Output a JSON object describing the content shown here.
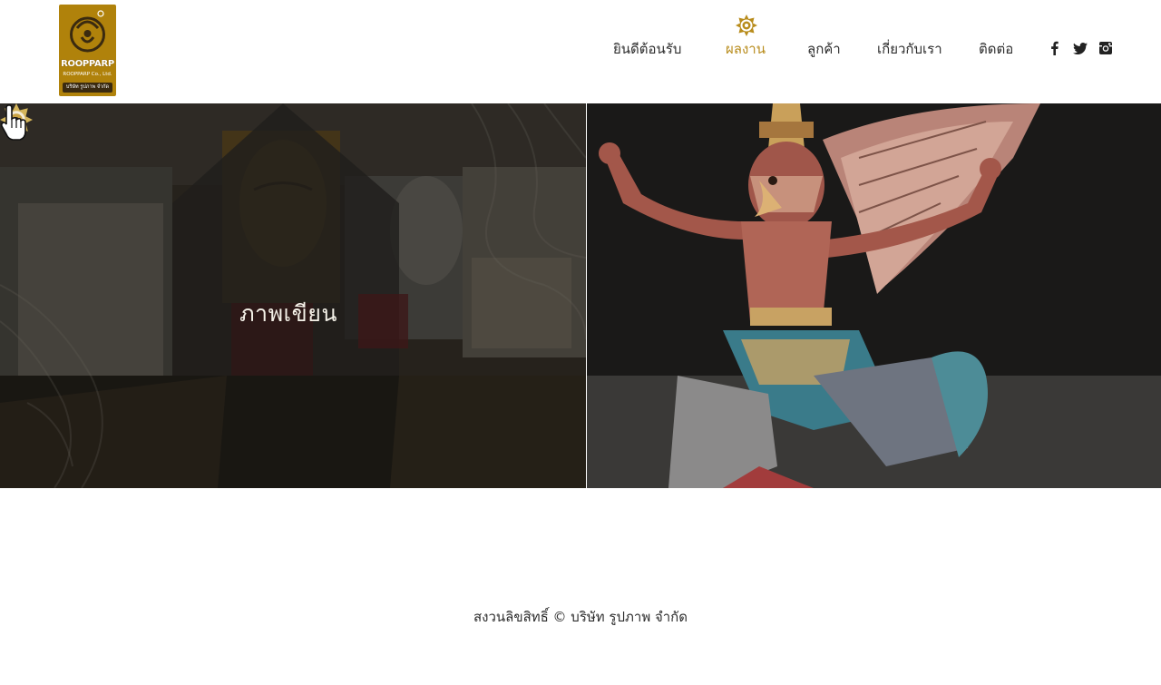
{
  "header": {
    "logo": {
      "brand": "ROOPPARP",
      "company_en": "ROOPPARP Co., Ltd.",
      "company_th": "บริษัท รูปภาพ จำกัด"
    },
    "nav": [
      {
        "label": "ยินดีต้อนรับ",
        "active": false
      },
      {
        "label": "ผลงาน",
        "active": true
      },
      {
        "label": "ลูกค้า",
        "active": false
      },
      {
        "label": "เกี่ยวกับเรา",
        "active": false
      },
      {
        "label": "ติดต่อ",
        "active": false
      }
    ],
    "social": [
      "facebook-icon",
      "twitter-icon",
      "instagram-icon"
    ]
  },
  "gallery": {
    "tiles": [
      {
        "title": "ภาพเขียน",
        "hovered": true
      },
      {
        "title": "",
        "hovered": false
      }
    ]
  },
  "footer": {
    "copyright": "สงวนลิขสิทธิ์ © บริษัท รูปภาพ จำกัด"
  },
  "colors": {
    "accent": "#b88c1c",
    "logo_bg": "#b0820b",
    "text": "#2d2d2d"
  }
}
